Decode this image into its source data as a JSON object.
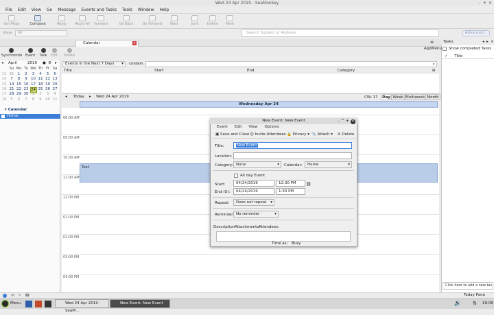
{
  "window": {
    "title": "Wed 24 Apr 2019 - SeaMonkey"
  },
  "menubar": [
    "File",
    "Edit",
    "View",
    "Go",
    "Message",
    "Events and Tasks",
    "Tools",
    "Window",
    "Help"
  ],
  "toolbar": {
    "get_msgs": "Get Msgs",
    "compose": "Compose",
    "reply": "Reply",
    "reply_all": "Reply All",
    "forward": "Forward",
    "go_back": "Go Back",
    "go_forward": "Go Forward",
    "next": "Next",
    "junk": "Junk",
    "delete": "Delete",
    "mark": "Mark"
  },
  "view_row": {
    "label": "View:",
    "value": "All",
    "search_placeholder": "Search Subject or Address",
    "advanced": "Advanced..."
  },
  "tabs": {
    "calendar": "Calendar"
  },
  "left_tools": {
    "synchronize": "Synchronize",
    "event": "Event",
    "task": "Task",
    "edit": "Edit",
    "delete": "Delete"
  },
  "minical": {
    "month": "April",
    "year": "2019",
    "dow": [
      "Su",
      "Mo",
      "Tu",
      "We",
      "Th",
      "Fr",
      "Sa"
    ],
    "weeks": [
      {
        "wk": "13",
        "days": [
          "31",
          "1",
          "2",
          "3",
          "4",
          "5",
          "6"
        ]
      },
      {
        "wk": "14",
        "days": [
          "7",
          "8",
          "9",
          "10",
          "11",
          "12",
          "13"
        ]
      },
      {
        "wk": "15",
        "days": [
          "14",
          "15",
          "16",
          "17",
          "18",
          "19",
          "20"
        ]
      },
      {
        "wk": "16",
        "days": [
          "21",
          "22",
          "23",
          "24",
          "25",
          "26",
          "27"
        ]
      },
      {
        "wk": "17",
        "days": [
          "28",
          "29",
          "30",
          "1",
          "2",
          "3",
          "4"
        ]
      },
      {
        "wk": "18",
        "days": [
          "5",
          "6",
          "7",
          "8",
          "9",
          "10",
          "11"
        ]
      }
    ]
  },
  "calendars": {
    "header": "Calendar",
    "home": "Home"
  },
  "filter": {
    "range": "Events in the Next 7 Days",
    "contain_label": "contain"
  },
  "list_columns": {
    "title": "Title",
    "start": "Start",
    "end": "End",
    "category": "Category"
  },
  "nav": {
    "today": "Today",
    "date": "Wed 24 Apr 2019",
    "cw": "CW: 17",
    "day": "Day",
    "week": "Week",
    "multiweek": "Multiweek",
    "month": "Month"
  },
  "day_view": {
    "header": "Wednesday Apr 24",
    "hours": [
      "08:00 AM",
      "09:00 AM",
      "10:00 AM",
      "11:00 AM",
      "12:00 PM",
      "01:00 PM",
      "02:00 PM",
      "03:00 PM",
      "04:00 PM"
    ],
    "event_title": "Test"
  },
  "tasks_pane": {
    "header": "Tasks",
    "appmenu": "AppMenu",
    "show_completed": "Show completed Tasks",
    "title_col": "Title",
    "add_task": "Click here to add a new tas"
  },
  "statusbar": {
    "today_pane": "Today Pane"
  },
  "taskbar": {
    "menu": "Menu",
    "app1": "Wed 24 Apr 2019 - SeaM...",
    "app2": "New Event: New Event",
    "clock": "19:06"
  },
  "dialog": {
    "title": "New Event: New Event",
    "menu": [
      "Event",
      "Edit",
      "View",
      "Options"
    ],
    "tools": {
      "save_close": "Save and Close",
      "invite": "Invite Attendees",
      "privacy": "Privacy",
      "attach": "Attach",
      "delete": "Delete"
    },
    "title_label": "Title:",
    "title_value": "New Event",
    "location_label": "Location:",
    "location_value": "",
    "category_label": "Category:",
    "category_value": "None",
    "calendar_label": "Calendar:",
    "calendar_value": "Home",
    "allday_label": "All day Event",
    "start_label": "Start:",
    "start_date": "04/24/2019",
    "start_time": "12:30 PM",
    "end_label": "End (U):",
    "end_date": "04/24/2019",
    "end_time": "1:30 PM",
    "repeat_label": "Repeat:",
    "repeat_value": "Does not repeat",
    "reminder_label": "Reminder:",
    "reminder_value": "No reminder",
    "tabs": {
      "description": "Description",
      "attachments": "Attachments:",
      "attendees": "Attendees:"
    },
    "time_as_label": "Time as:",
    "time_as_value": "Busy"
  }
}
